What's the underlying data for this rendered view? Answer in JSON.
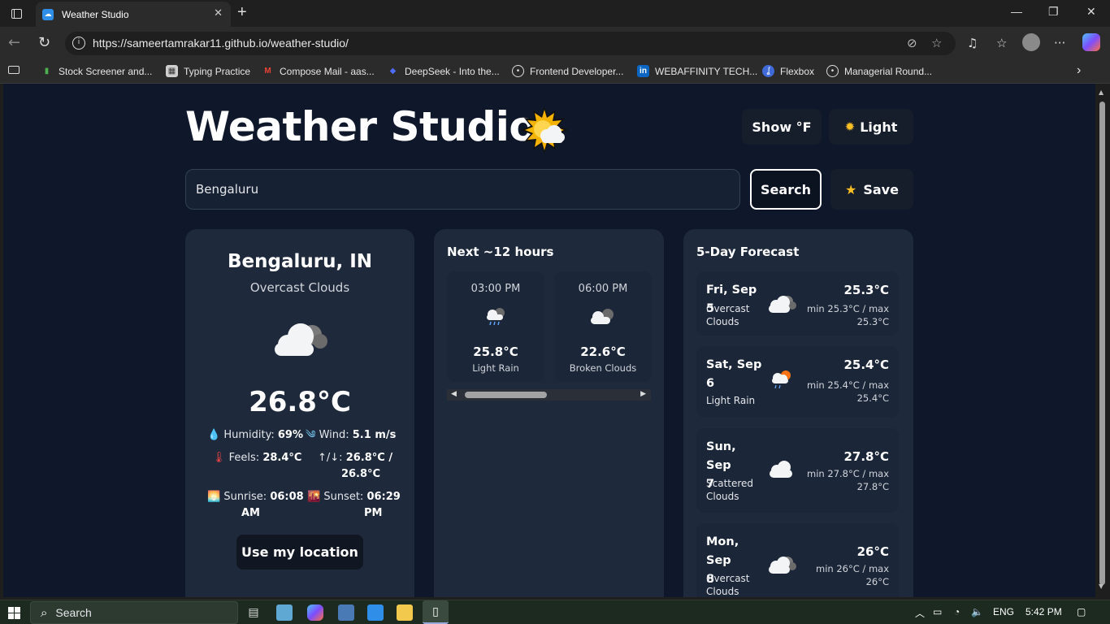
{
  "browser": {
    "tab_title": "Weather Studio",
    "url": "https://sameertamrakar11.github.io/weather-studio/",
    "bookmarks": [
      {
        "label": "Stock Screener and...",
        "icon": "bar-chart-icon",
        "color": "#4caf50"
      },
      {
        "label": "Typing Practice",
        "icon": "keyboard-icon",
        "color": "#cfcfcf"
      },
      {
        "label": "Compose Mail - aas...",
        "icon": "gmail-icon",
        "color": "#ea4335"
      },
      {
        "label": "DeepSeek - Into the...",
        "icon": "deepseek-icon",
        "color": "#4d6bfe"
      },
      {
        "label": "Frontend Developer...",
        "icon": "globe-icon",
        "color": "#e6e6e6"
      },
      {
        "label": "WEBAFFINITY TECH...",
        "icon": "linkedin-icon",
        "color": "#0a66c2"
      },
      {
        "label": "Flexbox",
        "icon": "flexbox-icon",
        "color": "#3f6ad8"
      },
      {
        "label": "Managerial Round...",
        "icon": "globe-icon",
        "color": "#e6e6e6"
      }
    ]
  },
  "app": {
    "title": "Weather Studio",
    "unit_toggle": "Show °F",
    "theme_toggle": "Light",
    "search_value": "Bengaluru",
    "search_button": "Search",
    "save_button": "Save"
  },
  "current": {
    "city": "Bengaluru, IN",
    "description": "Overcast Clouds",
    "temperature": "26.8°C",
    "humidity_label": "Humidity:",
    "humidity": "69%",
    "wind_label": "Wind:",
    "wind": "5.1 m/s",
    "feels_label": "Feels:",
    "feels": "28.4°C",
    "minmax_label": "↑/↓:",
    "minmax_line1": "26.8°C /",
    "minmax_line2": "26.8°C",
    "sunrise_label": "Sunrise:",
    "sunrise_line1": "06:08",
    "sunrise_line2": "AM",
    "sunset_label": "Sunset:",
    "sunset_line1": "06:29",
    "sunset_line2": "PM",
    "location_button": "Use my location"
  },
  "hourly": {
    "title": "Next ~12 hours",
    "items": [
      {
        "time": "03:00 PM",
        "temp": "25.8°C",
        "desc": "Light Rain",
        "icon": "rain-cloud-icon"
      },
      {
        "time": "06:00 PM",
        "temp": "22.6°C",
        "desc": "Broken Clouds",
        "icon": "broken-clouds-icon"
      }
    ]
  },
  "forecast": {
    "title": "5-Day Forecast",
    "days": [
      {
        "line1": "Fri, Sep 5",
        "line2": "",
        "desc1": "Overcast",
        "desc2": "Clouds",
        "temp": "25.3°C",
        "mm1": "min 25.3°C / max",
        "mm2": "25.3°C",
        "icon": "overcast-clouds-icon"
      },
      {
        "line1": "Sat, Sep",
        "line2": "6",
        "desc1": "Light Rain",
        "desc2": "",
        "temp": "25.4°C",
        "mm1": "min 25.4°C / max",
        "mm2": "25.4°C",
        "icon": "sun-rain-icon"
      },
      {
        "line1": "Sun, Sep",
        "line2": "7",
        "desc1": "Scattered",
        "desc2": "Clouds",
        "temp": "27.8°C",
        "mm1": "min 27.8°C / max",
        "mm2": "27.8°C",
        "icon": "scattered-clouds-icon"
      },
      {
        "line1": "Mon, Sep",
        "line2": "8",
        "desc1": "Overcast",
        "desc2": "Clouds",
        "temp": "26°C",
        "mm1": "min 26°C / max",
        "mm2": "26°C",
        "icon": "overcast-clouds-icon"
      }
    ]
  },
  "taskbar": {
    "search_label": "Search",
    "language": "ENG",
    "time": "5:42 PM"
  }
}
